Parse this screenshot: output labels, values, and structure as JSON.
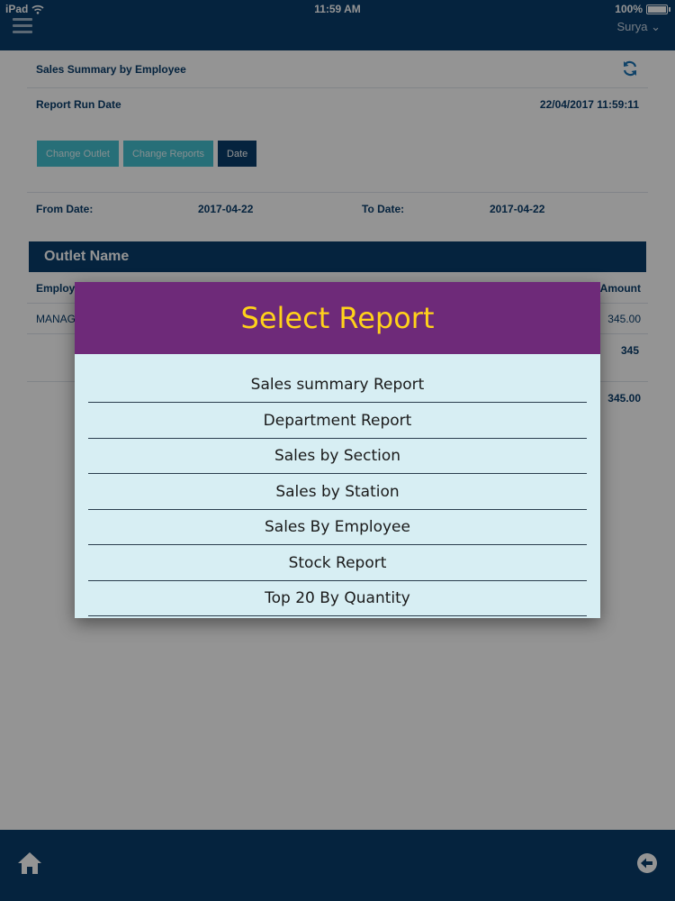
{
  "status_bar": {
    "device": "iPad",
    "time": "11:59 AM",
    "battery": "100%"
  },
  "header": {
    "user": "Surya"
  },
  "report": {
    "title": "Sales Summary by Employee",
    "run_date_label": "Report Run Date",
    "run_date_value": "22/04/2017 11:59:11",
    "buttons": [
      "Change Outlet",
      "Change Reports",
      "Date"
    ],
    "from_label": "From Date:",
    "from_value": "2017-04-22",
    "to_label": "To Date:",
    "to_value": "2017-04-22",
    "outlet_header": "Outlet Name",
    "col_employee": "Employ",
    "col_amount": "Amount",
    "row_employee": "MANAG",
    "row_amount": "345.00",
    "subtotal": "345",
    "total": "345.00"
  },
  "modal": {
    "title": "Select Report",
    "items": [
      "Sales summary Report",
      "Department Report",
      "Sales by Section",
      "Sales by Station",
      "Sales By Employee",
      "Stock Report",
      "Top 20 By Quantity"
    ]
  },
  "icons": {
    "menu": "hamburger-icon",
    "refresh": "refresh-icon",
    "home": "home-icon",
    "back": "back-arrow-icon"
  },
  "colors": {
    "navy": "#0a3d6b",
    "teal_button": "#44bfcf",
    "modal_header": "#6e2a79",
    "modal_title": "#ffd21a",
    "modal_body": "#d7eef3"
  }
}
